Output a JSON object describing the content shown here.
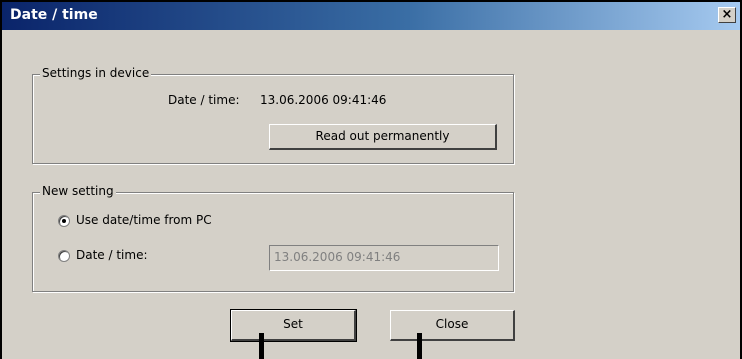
{
  "window": {
    "title": "Date / time",
    "close_glyph": "×"
  },
  "device_settings": {
    "legend": "Settings in device",
    "datetime_label": "Date / time:",
    "datetime_value": "13.06.2006 09:41:46",
    "readout_button": "Read out permanently"
  },
  "new_setting": {
    "legend": "New setting",
    "options": [
      {
        "label": "Use date/time from PC",
        "selected": true
      },
      {
        "label": "Date / time:",
        "selected": false
      }
    ],
    "datetime_field": {
      "value": "13.06.2006 09:41:46",
      "disabled": true
    }
  },
  "buttons": {
    "set": "Set",
    "close": "Close"
  },
  "colors": {
    "face": "#d4d0c8",
    "title_start": "#0a246a",
    "title_end": "#a6caf0"
  }
}
